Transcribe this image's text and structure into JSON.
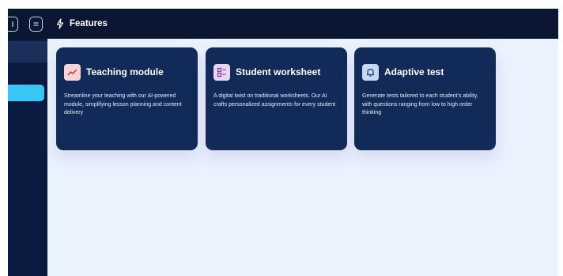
{
  "header": {
    "title": "Features",
    "icon": "lightning-bolt-icon"
  },
  "sidebar": {
    "top_buttons": [
      "panel-toggle-icon",
      "menu-lines-icon"
    ],
    "active_color": "#3bc7f5"
  },
  "features": [
    {
      "title": "Teaching module",
      "description": "Streamline your teaching with our AI-powered module, simplifying lesson planning and content delivery",
      "icon": "trend-chart-icon",
      "icon_bg": "#f9d3d7"
    },
    {
      "title": "Student worksheet",
      "description": "A digital twist on traditional worksheets. Our AI crafts personalized assignments for every student",
      "icon": "worksheet-icon",
      "icon_bg": "#ead4f2"
    },
    {
      "title": "Adaptive test",
      "description": "Generate tests tailored to each student's ability, with questions ranging from low to high order thinking",
      "icon": "bell-icon",
      "icon_bg": "#c9d6f2"
    }
  ]
}
